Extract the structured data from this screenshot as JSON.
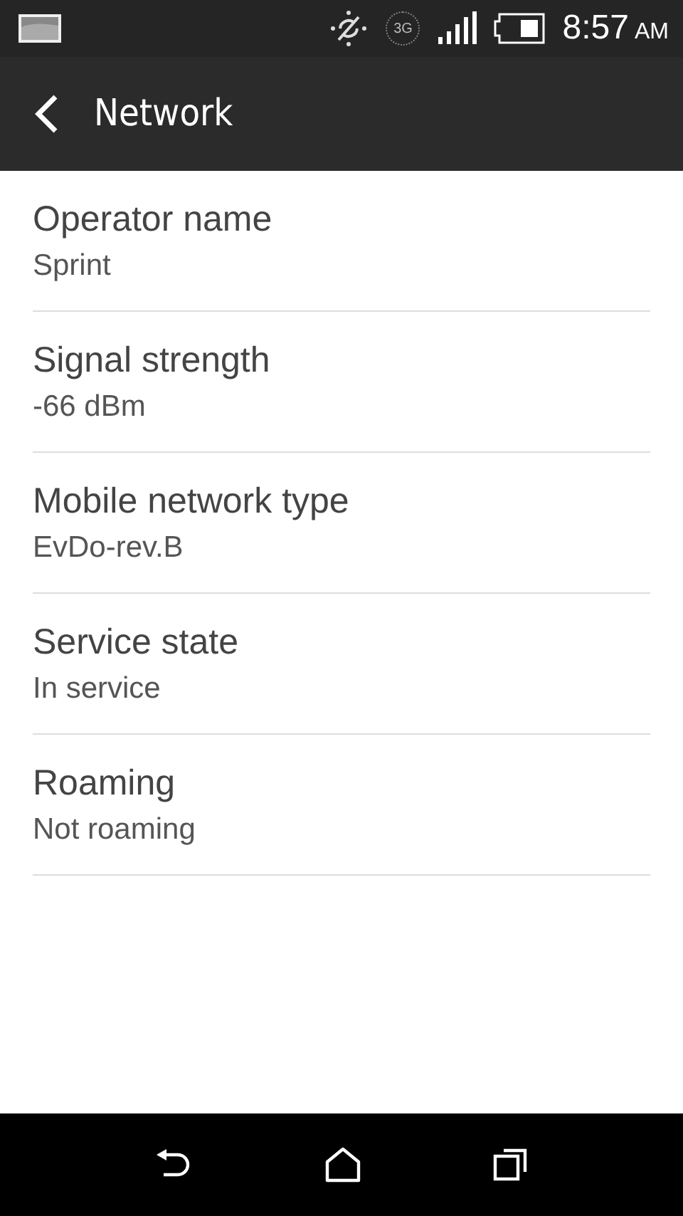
{
  "status_bar": {
    "network_label": "3G",
    "time": "8:57",
    "meridiem": "AM"
  },
  "app_bar": {
    "title": "Network"
  },
  "items": [
    {
      "title": "Operator name",
      "value": "Sprint"
    },
    {
      "title": "Signal strength",
      "value": "-66 dBm"
    },
    {
      "title": "Mobile network type",
      "value": "EvDo-rev.B"
    },
    {
      "title": "Service state",
      "value": "In service"
    },
    {
      "title": "Roaming",
      "value": "Not roaming"
    }
  ]
}
